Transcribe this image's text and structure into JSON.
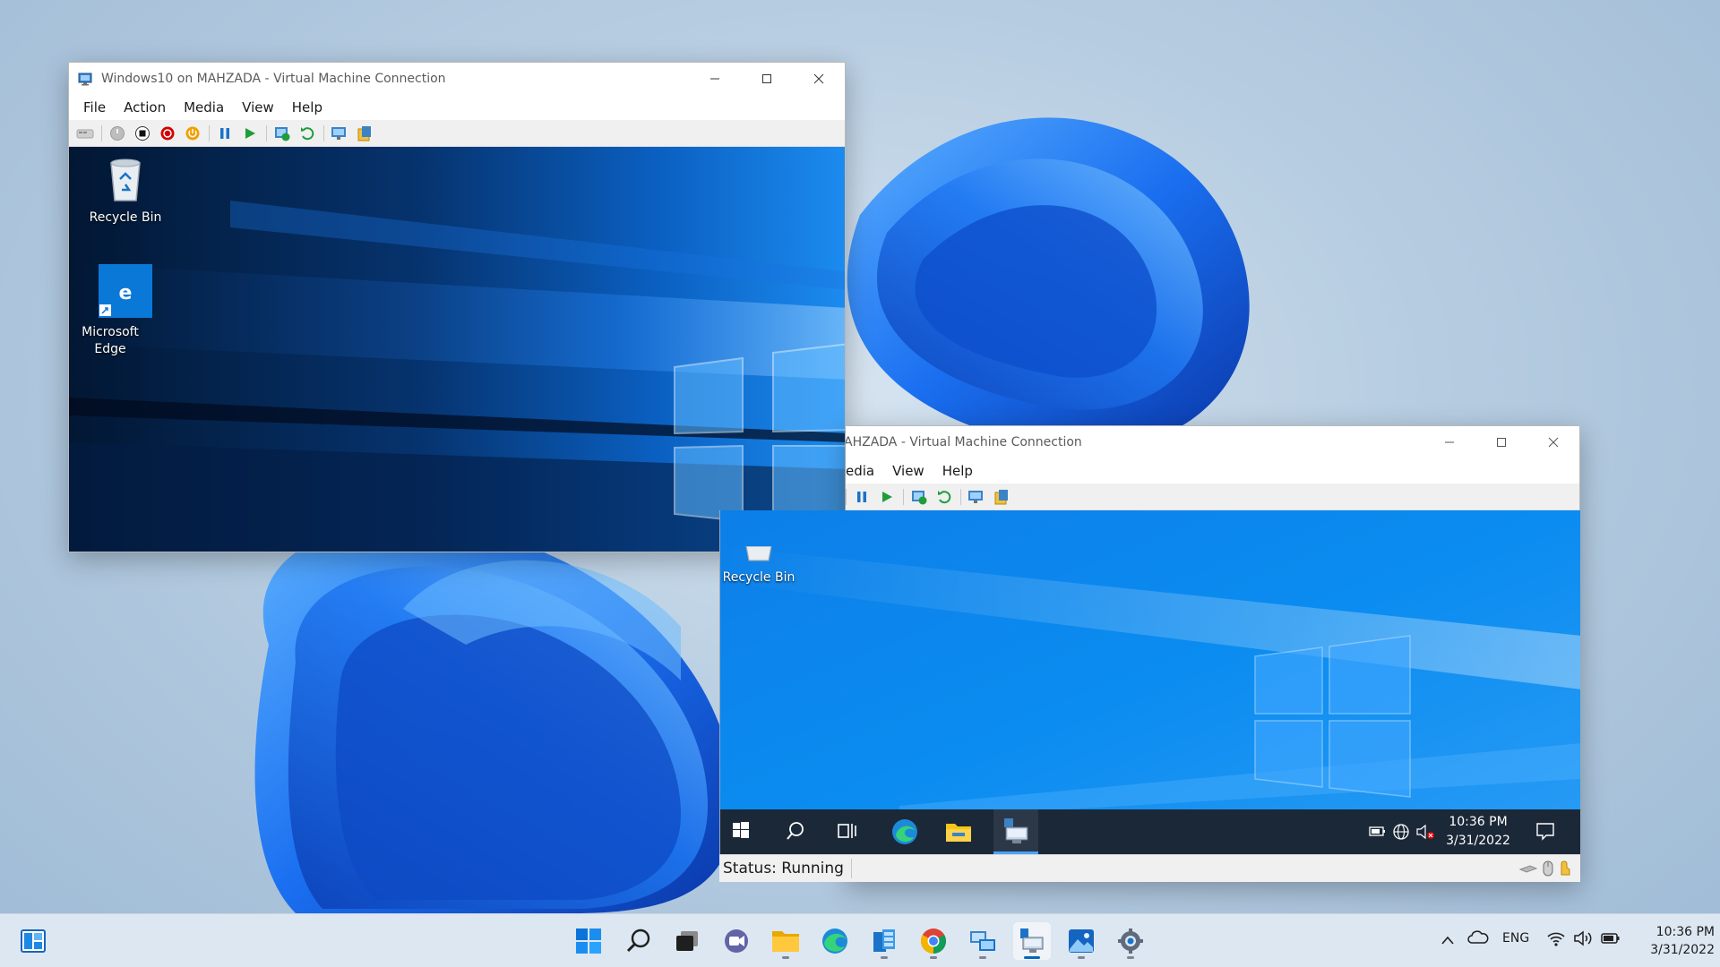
{
  "host_taskbar": {
    "widgets_icon": "widgets-icon",
    "pinned_apps": [
      {
        "name": "start-icon"
      },
      {
        "name": "search-icon"
      },
      {
        "name": "task-view-icon"
      },
      {
        "name": "chat-icon"
      },
      {
        "name": "file-explorer-icon"
      },
      {
        "name": "edge-icon"
      },
      {
        "name": "hyper-v-manager-icon"
      },
      {
        "name": "chrome-icon"
      },
      {
        "name": "network-icon"
      },
      {
        "name": "vm-connection-icon"
      },
      {
        "name": "photos-icon"
      },
      {
        "name": "settings-icon"
      }
    ],
    "tray": {
      "language": "ENG",
      "time": "10:36 PM",
      "date": "3/31/2022"
    }
  },
  "vm_window_1": {
    "title": "Windows10 on MAHZADA - Virtual Machine Connection",
    "menu": [
      "File",
      "Action",
      "Media",
      "View",
      "Help"
    ],
    "desktop_icons": [
      {
        "label": "Recycle Bin",
        "icon": "recycle-bin-icon"
      },
      {
        "label": "Microsoft Edge",
        "icon": "edge-legacy-icon"
      }
    ]
  },
  "vm_window_2": {
    "title": "AHZADA - Virtual Machine Connection",
    "menu": [
      "edia",
      "View",
      "Help"
    ],
    "desktop_icons": [
      {
        "label": "Recycle Bin",
        "icon": "recycle-bin-icon"
      }
    ],
    "guest_taskbar": {
      "time": "10:36 PM",
      "date": "3/31/2022"
    },
    "status": "Status: Running"
  },
  "colors": {
    "host_accent": "#0067c0",
    "guest_taskbar": "#1b2838",
    "stop_red": "#d40000",
    "power_orange": "#f0a000",
    "play_green": "#1e9e3a"
  }
}
